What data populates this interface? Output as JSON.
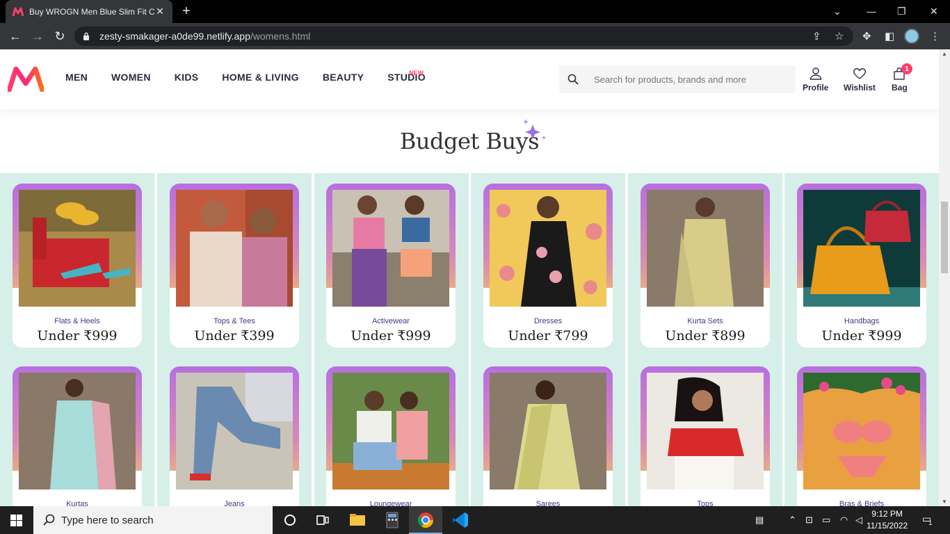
{
  "browser": {
    "tab_title": "Buy WROGN Men Blue Slim Fit C",
    "url_host": "zesty-smakager-a0de99.netlify.app",
    "url_path": "/womens.html"
  },
  "header": {
    "menu": [
      "MEN",
      "WOMEN",
      "KIDS",
      "HOME & LIVING",
      "BEAUTY",
      "STUDIO"
    ],
    "studio_badge": "NEW",
    "search_placeholder": "Search for products, brands and more",
    "profile_label": "Profile",
    "wishlist_label": "Wishlist",
    "bag_label": "Bag",
    "bag_count": "1"
  },
  "section": {
    "title": "Budget Buys"
  },
  "products": [
    {
      "category": "Flats & Heels",
      "price": "Under ₹999"
    },
    {
      "category": "Tops & Tees",
      "price": "Under ₹399"
    },
    {
      "category": "Activewear",
      "price": "Under ₹999"
    },
    {
      "category": "Dresses",
      "price": "Under ₹799"
    },
    {
      "category": "Kurta Sets",
      "price": "Under ₹899"
    },
    {
      "category": "Handbags",
      "price": "Under ₹999"
    },
    {
      "category": "Kurtas",
      "price": ""
    },
    {
      "category": "Jeans",
      "price": ""
    },
    {
      "category": "Loungewear",
      "price": ""
    },
    {
      "category": "Sarees",
      "price": ""
    },
    {
      "category": "Tops",
      "price": ""
    },
    {
      "category": "Bras & Briefs",
      "price": ""
    }
  ],
  "taskbar": {
    "search_placeholder": "Type here to search",
    "time": "9:12 PM",
    "date": "11/15/2022",
    "notifications": "1"
  },
  "colors": {
    "accent": "#ff3f6c",
    "panel_bg": "#d6efe9",
    "card_gradient_top": "#b86ee0",
    "card_gradient_bottom": "#f4c16a"
  }
}
